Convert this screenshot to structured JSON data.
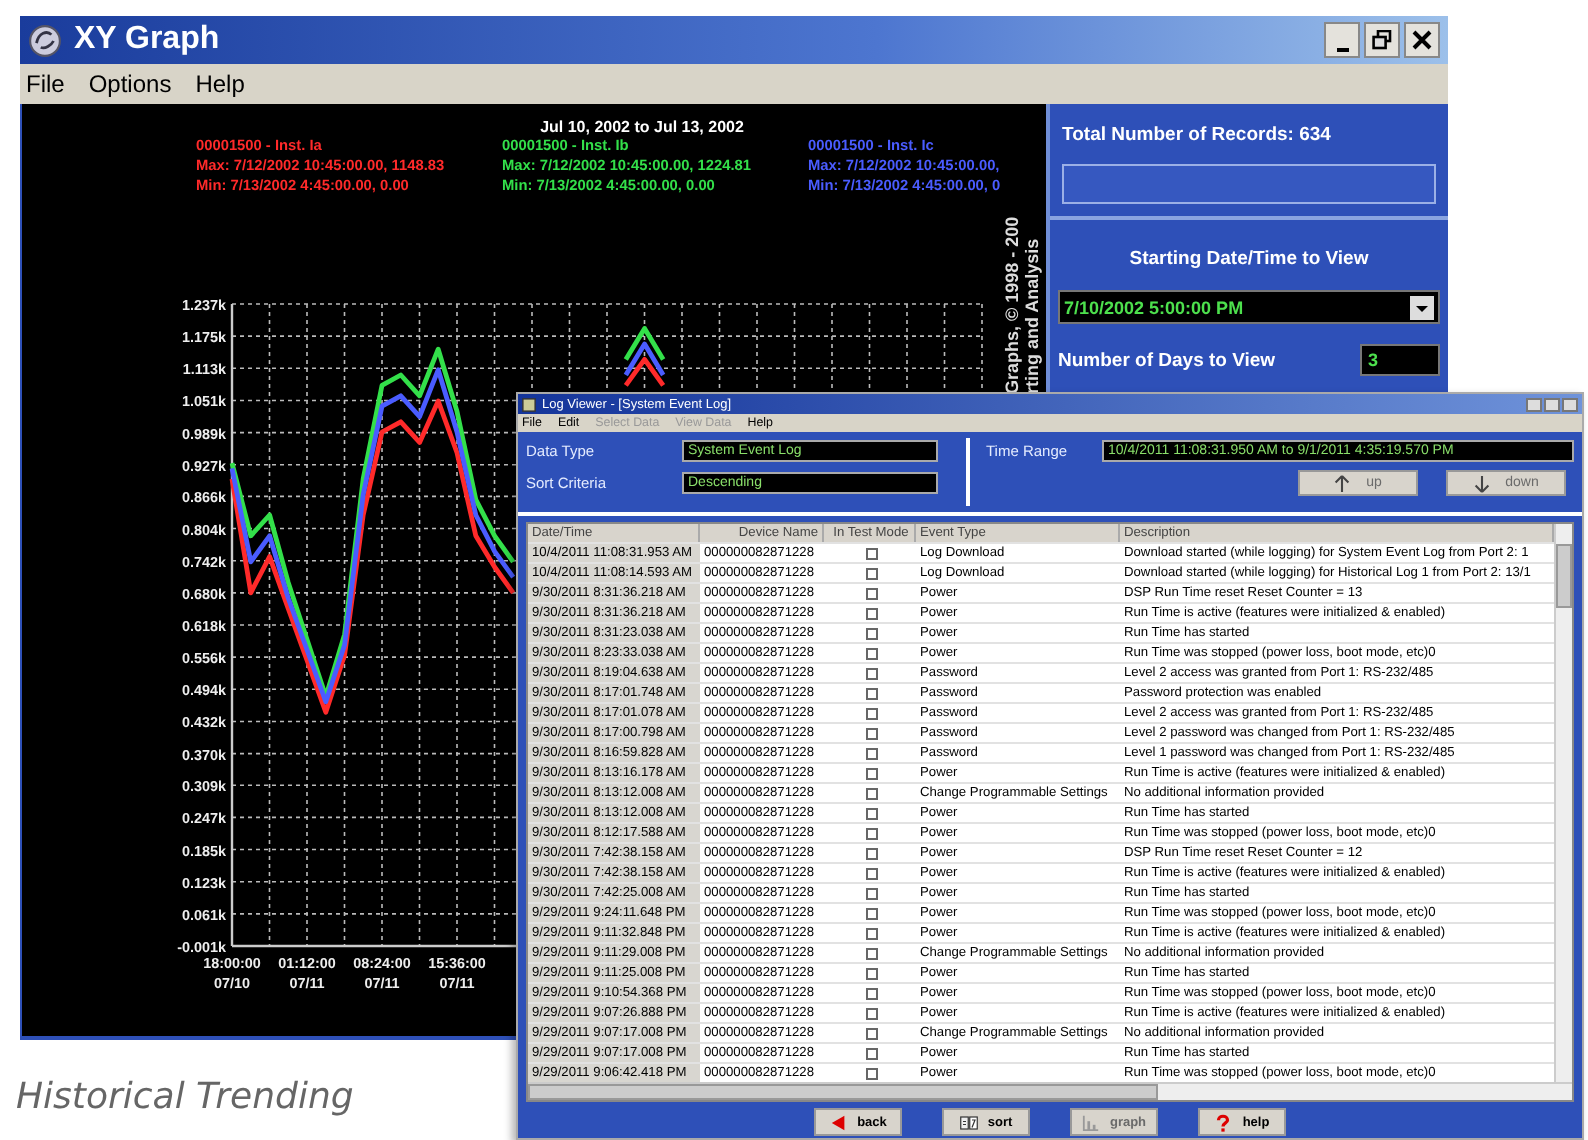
{
  "graph_window": {
    "title": "XY Graph",
    "menu": [
      {
        "label": "File"
      },
      {
        "label": "Options"
      },
      {
        "label": "Help"
      }
    ],
    "chart_data": {
      "type": "line",
      "title": "Jul 10, 2002 to Jul 13, 2002",
      "categories": [
        "18:00:00 07/10",
        null,
        null,
        null,
        "01:12:00 07/11",
        null,
        null,
        null,
        "08:24:00 07/11",
        null,
        null,
        null,
        "15:36:00 07/11",
        null,
        null,
        null,
        null,
        null,
        null,
        null,
        null,
        null,
        null,
        null,
        null,
        null,
        null,
        null,
        null,
        null,
        null,
        null,
        null,
        null,
        null,
        null,
        null,
        null,
        null,
        null,
        null
      ],
      "series": [
        {
          "name": "00001500 - Inst. Ia",
          "color": "#ff2a2a",
          "values": [
            0.9,
            0.68,
            0.75,
            0.65,
            0.55,
            0.45,
            0.56,
            0.83,
            0.99,
            1.01,
            0.97,
            1.05,
            0.95,
            0.79,
            0.73,
            0.68,
            null,
            null,
            null,
            null,
            null,
            1.08,
            1.13,
            1.08,
            null,
            null,
            null,
            null,
            null,
            null,
            null,
            null,
            null,
            null,
            null,
            null,
            null,
            null,
            null,
            null,
            null
          ]
        },
        {
          "name": "00001500 - Inst. Ib",
          "color": "#33e04a",
          "values": [
            0.93,
            0.79,
            0.83,
            0.7,
            0.59,
            0.48,
            0.6,
            0.9,
            1.08,
            1.1,
            1.06,
            1.15,
            1.03,
            0.86,
            0.79,
            0.74,
            null,
            null,
            null,
            null,
            null,
            1.13,
            1.19,
            1.13,
            null,
            null,
            null,
            null,
            null,
            null,
            null,
            null,
            null,
            null,
            null,
            null,
            null,
            null,
            null,
            null,
            null
          ]
        },
        {
          "name": "00001500 - Inst. Ic",
          "color": "#4a5cff",
          "values": [
            0.92,
            0.74,
            0.79,
            0.67,
            0.57,
            0.47,
            0.58,
            0.87,
            1.04,
            1.06,
            1.02,
            1.11,
            0.99,
            0.83,
            0.76,
            0.71,
            null,
            null,
            null,
            null,
            null,
            1.1,
            1.16,
            1.1,
            null,
            null,
            null,
            null,
            null,
            null,
            null,
            null,
            null,
            null,
            null,
            null,
            null,
            null,
            null,
            null,
            null
          ]
        }
      ],
      "ylim": [
        -0.001,
        1.237
      ],
      "grid": true,
      "yticks": [
        {
          "value": 1.237,
          "label": "1.237k"
        },
        {
          "value": 1.175,
          "label": "1.175k"
        },
        {
          "value": 1.113,
          "label": "1.113k"
        },
        {
          "value": 1.051,
          "label": "1.051k"
        },
        {
          "value": 0.989,
          "label": "0.989k"
        },
        {
          "value": 0.927,
          "label": "0.927k"
        },
        {
          "value": 0.866,
          "label": "0.866k"
        },
        {
          "value": 0.804,
          "label": "0.804k"
        },
        {
          "value": 0.742,
          "label": "0.742k"
        },
        {
          "value": 0.68,
          "label": "0.680k"
        },
        {
          "value": 0.618,
          "label": "0.618k"
        },
        {
          "value": 0.556,
          "label": "0.556k"
        },
        {
          "value": 0.494,
          "label": "0.494k"
        },
        {
          "value": 0.432,
          "label": "0.432k"
        },
        {
          "value": 0.37,
          "label": "0.370k"
        },
        {
          "value": 0.309,
          "label": "0.309k"
        },
        {
          "value": 0.247,
          "label": "0.247k"
        },
        {
          "value": 0.185,
          "label": "0.185k"
        },
        {
          "value": 0.123,
          "label": "0.123k"
        },
        {
          "value": 0.061,
          "label": "0.061k"
        },
        {
          "value": -0.001,
          "label": "-0.001k"
        }
      ]
    },
    "legend": [
      {
        "max": "Max: 7/12/2002 10:45:00.00, 1148.83",
        "min": "Min: 7/13/2002 4:45:00.00, 0.00"
      },
      {
        "max": "Max: 7/12/2002 10:45:00.00, 1224.81",
        "min": "Min: 7/13/2002 4:45:00.00, 0.00"
      },
      {
        "max": "Max: 7/12/2002 10:45:00.00,",
        "min": "Min: 7/13/2002 4:45:00.00, 0"
      }
    ],
    "credit_lines": [
      "Graphs, © 1998 - 200",
      "rting and Analysis"
    ],
    "panel": {
      "records_label": "Total Number of Records: 634",
      "start_label": "Starting Date/Time to View",
      "start_value": "7/10/2002 5:00:00 PM",
      "days_label": "Number of Days to View",
      "days_value": "3"
    }
  },
  "log_window": {
    "title": "Log Viewer - [System Event Log]",
    "menu": [
      {
        "label": "File",
        "disabled": false
      },
      {
        "label": "Edit",
        "disabled": false
      },
      {
        "label": "Select Data",
        "disabled": true
      },
      {
        "label": "View Data",
        "disabled": true
      },
      {
        "label": "Help",
        "disabled": false
      }
    ],
    "data_type_label": "Data Type",
    "data_type": "System Event Log",
    "sort_label": "Sort Criteria",
    "sort": "Descending",
    "time_range_label": "Time Range",
    "time_range": "10/4/2011 11:08:31.950 AM to 9/1/2011 4:35:19.570 PM",
    "nav_buttons": [
      {
        "label": "up",
        "kind": "up",
        "disabled": true
      },
      {
        "label": "down",
        "kind": "down",
        "disabled": true
      }
    ],
    "columns": [
      "Date/Time",
      "Device Name",
      "In Test Mode",
      "Event Type",
      "Description"
    ],
    "rows": [
      {
        "date": "10/4/2011 11:08:31.953 AM",
        "device": "000000082871228",
        "in_test_mode": false,
        "event": "Log Download",
        "description": "Download started (while logging) for System Event Log from Port 2: 1"
      },
      {
        "date": "10/4/2011 11:08:14.593 AM",
        "device": "000000082871228",
        "in_test_mode": false,
        "event": "Log Download",
        "description": "Download started (while logging) for Historical Log 1 from Port 2: 13/1"
      },
      {
        "date": "9/30/2011 8:31:36.218 AM",
        "device": "000000082871228",
        "in_test_mode": false,
        "event": "Power",
        "description": "DSP Run Time reset Reset Counter = 13"
      },
      {
        "date": "9/30/2011 8:31:36.218 AM",
        "device": "000000082871228",
        "in_test_mode": false,
        "event": "Power",
        "description": "Run Time is active (features were initialized & enabled)"
      },
      {
        "date": "9/30/2011 8:31:23.038 AM",
        "device": "000000082871228",
        "in_test_mode": false,
        "event": "Power",
        "description": "Run Time has started"
      },
      {
        "date": "9/30/2011 8:23:33.038 AM",
        "device": "000000082871228",
        "in_test_mode": false,
        "event": "Power",
        "description": "Run Time was stopped (power loss, boot mode, etc)0"
      },
      {
        "date": "9/30/2011 8:19:04.638 AM",
        "device": "000000082871228",
        "in_test_mode": false,
        "event": "Password",
        "description": "Level 2 access was granted from Port 1: RS-232/485"
      },
      {
        "date": "9/30/2011 8:17:01.748 AM",
        "device": "000000082871228",
        "in_test_mode": false,
        "event": "Password",
        "description": "Password protection was enabled"
      },
      {
        "date": "9/30/2011 8:17:01.078 AM",
        "device": "000000082871228",
        "in_test_mode": false,
        "event": "Password",
        "description": "Level 2 access was granted from Port 1: RS-232/485"
      },
      {
        "date": "9/30/2011 8:17:00.798 AM",
        "device": "000000082871228",
        "in_test_mode": false,
        "event": "Password",
        "description": "Level 2 password was changed from Port 1: RS-232/485"
      },
      {
        "date": "9/30/2011 8:16:59.828 AM",
        "device": "000000082871228",
        "in_test_mode": false,
        "event": "Password",
        "description": "Level 1 password was changed from Port 1: RS-232/485"
      },
      {
        "date": "9/30/2011 8:13:16.178 AM",
        "device": "000000082871228",
        "in_test_mode": false,
        "event": "Power",
        "description": "Run Time is active (features were initialized & enabled)"
      },
      {
        "date": "9/30/2011 8:13:12.008 AM",
        "device": "000000082871228",
        "in_test_mode": false,
        "event": "Change Programmable Settings",
        "description": "No additional information provided"
      },
      {
        "date": "9/30/2011 8:13:12.008 AM",
        "device": "000000082871228",
        "in_test_mode": false,
        "event": "Power",
        "description": "Run Time has started"
      },
      {
        "date": "9/30/2011 8:12:17.588 AM",
        "device": "000000082871228",
        "in_test_mode": false,
        "event": "Power",
        "description": "Run Time was stopped (power loss, boot mode, etc)0"
      },
      {
        "date": "9/30/2011 7:42:38.158 AM",
        "device": "000000082871228",
        "in_test_mode": false,
        "event": "Power",
        "description": "DSP Run Time reset Reset Counter = 12"
      },
      {
        "date": "9/30/2011 7:42:38.158 AM",
        "device": "000000082871228",
        "in_test_mode": false,
        "event": "Power",
        "description": "Run Time is active (features were initialized & enabled)"
      },
      {
        "date": "9/30/2011 7:42:25.008 AM",
        "device": "000000082871228",
        "in_test_mode": false,
        "event": "Power",
        "description": "Run Time has started"
      },
      {
        "date": "9/29/2011 9:24:11.648 PM",
        "device": "000000082871228",
        "in_test_mode": false,
        "event": "Power",
        "description": "Run Time was stopped (power loss, boot mode, etc)0"
      },
      {
        "date": "9/29/2011 9:11:32.848 PM",
        "device": "000000082871228",
        "in_test_mode": false,
        "event": "Power",
        "description": "Run Time is active (features were initialized & enabled)"
      },
      {
        "date": "9/29/2011 9:11:29.008 PM",
        "device": "000000082871228",
        "in_test_mode": false,
        "event": "Change Programmable Settings",
        "description": "No additional information provided"
      },
      {
        "date": "9/29/2011 9:11:25.008 PM",
        "device": "000000082871228",
        "in_test_mode": false,
        "event": "Power",
        "description": "Run Time has started"
      },
      {
        "date": "9/29/2011 9:10:54.368 PM",
        "device": "000000082871228",
        "in_test_mode": false,
        "event": "Power",
        "description": "Run Time was stopped (power loss, boot mode, etc)0"
      },
      {
        "date": "9/29/2011 9:07:26.888 PM",
        "device": "000000082871228",
        "in_test_mode": false,
        "event": "Power",
        "description": "Run Time is active (features were initialized & enabled)"
      },
      {
        "date": "9/29/2011 9:07:17.008 PM",
        "device": "000000082871228",
        "in_test_mode": false,
        "event": "Change Programmable Settings",
        "description": "No additional information provided"
      },
      {
        "date": "9/29/2011 9:07:17.008 PM",
        "device": "000000082871228",
        "in_test_mode": false,
        "event": "Power",
        "description": "Run Time has started"
      },
      {
        "date": "9/29/2011 9:06:42.418 PM",
        "device": "000000082871228",
        "in_test_mode": false,
        "event": "Power",
        "description": "Run Time was stopped (power loss, boot mode, etc)0"
      }
    ],
    "bottom_buttons": [
      {
        "label": "back",
        "kind": "back",
        "disabled": false
      },
      {
        "label": "sort",
        "kind": "sort",
        "disabled": false
      },
      {
        "label": "graph",
        "kind": "graph",
        "disabled": true
      },
      {
        "label": "help",
        "kind": "help",
        "disabled": false
      }
    ]
  },
  "caption": "Historical Trending"
}
